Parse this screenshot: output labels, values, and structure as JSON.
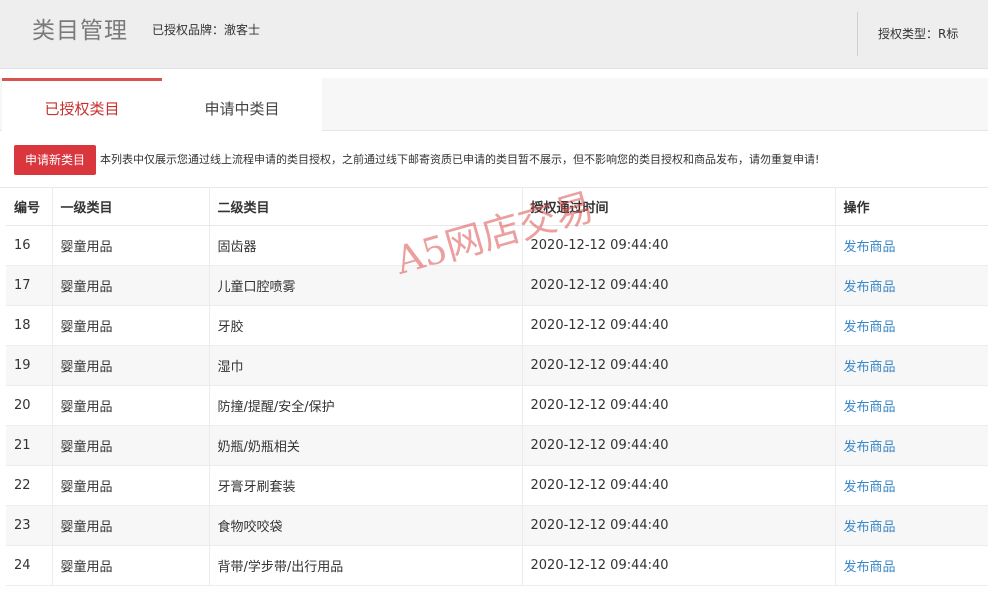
{
  "header": {
    "title": "类目管理",
    "brand_label": "已授权品牌：",
    "brand_value": "澈客士",
    "auth_type_label": "授权类型：",
    "auth_type_value": "R标"
  },
  "tabs": [
    {
      "label": "已授权类目",
      "active": true
    },
    {
      "label": "申请中类目",
      "active": false
    }
  ],
  "notice": {
    "button_label": "申请新类目",
    "text": "本列表中仅展示您通过线上流程申请的类目授权，之前通过线下邮寄资质已申请的类目暂不展示，但不影响您的类目授权和商品发布，请勿重复申请!"
  },
  "table": {
    "columns": [
      "编号",
      "一级类目",
      "二级类目",
      "授权通过时间",
      "操作"
    ],
    "rows": [
      {
        "id": "16",
        "level1": "婴童用品",
        "level2": "固齿器",
        "time": "2020-12-12 09:44:40",
        "action": "发布商品"
      },
      {
        "id": "17",
        "level1": "婴童用品",
        "level2": "儿童口腔喷雾",
        "time": "2020-12-12 09:44:40",
        "action": "发布商品"
      },
      {
        "id": "18",
        "level1": "婴童用品",
        "level2": "牙胶",
        "time": "2020-12-12 09:44:40",
        "action": "发布商品"
      },
      {
        "id": "19",
        "level1": "婴童用品",
        "level2": "湿巾",
        "time": "2020-12-12 09:44:40",
        "action": "发布商品"
      },
      {
        "id": "20",
        "level1": "婴童用品",
        "level2": "防撞/提醒/安全/保护",
        "time": "2020-12-12 09:44:40",
        "action": "发布商品"
      },
      {
        "id": "21",
        "level1": "婴童用品",
        "level2": "奶瓶/奶瓶相关",
        "time": "2020-12-12 09:44:40",
        "action": "发布商品"
      },
      {
        "id": "22",
        "level1": "婴童用品",
        "level2": "牙膏牙刷套装",
        "time": "2020-12-12 09:44:40",
        "action": "发布商品"
      },
      {
        "id": "23",
        "level1": "婴童用品",
        "level2": "食物咬咬袋",
        "time": "2020-12-12 09:44:40",
        "action": "发布商品"
      },
      {
        "id": "24",
        "level1": "婴童用品",
        "level2": "背带/学步带/出行用品",
        "time": "2020-12-12 09:44:40",
        "action": "发布商品"
      }
    ]
  },
  "watermark": "A5网店交易",
  "colors": {
    "accent": "#d9363e",
    "link": "#3a87c8",
    "watermark": "#dc5050"
  }
}
